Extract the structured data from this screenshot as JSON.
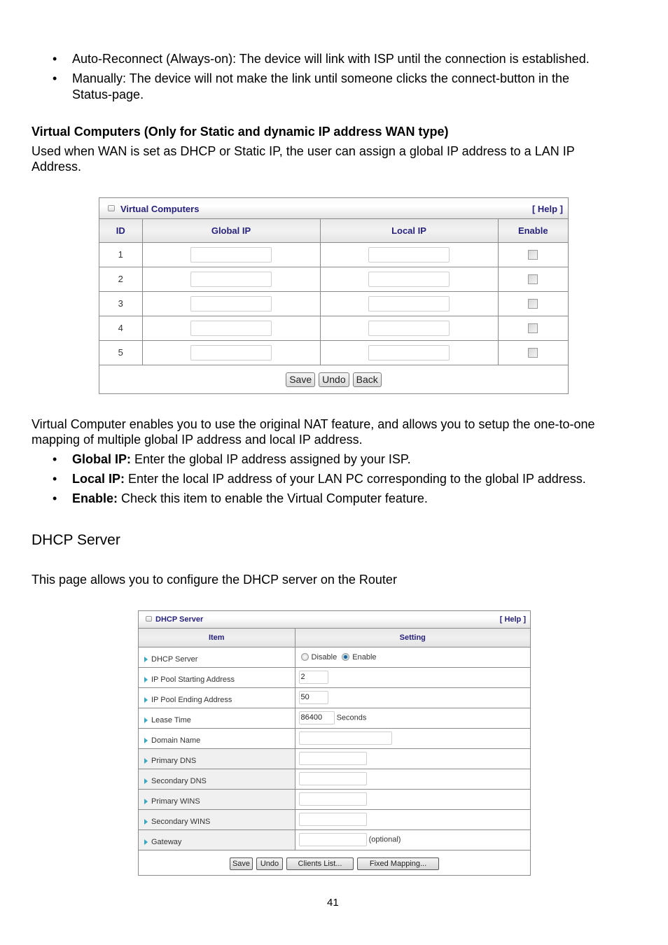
{
  "intro_bullets": [
    "Auto-Reconnect (Always-on): The device will link with ISP until the connection is established.",
    "Manually: The device will not make the link until someone clicks the connect-button in the",
    "Status-page."
  ],
  "virtual_section": {
    "heading": "Virtual Computers (Only for Static and dynamic IP address WAN type)",
    "desc_line1": "Used when WAN is set as DHCP or Static IP, the user can assign a global IP address to a LAN IP",
    "desc_line2": "Address."
  },
  "vc_panel": {
    "title": "Virtual Computers",
    "help": "[ Help ]",
    "columns": [
      "ID",
      "Global IP",
      "Local IP",
      "Enable"
    ],
    "rows": [
      {
        "id": "1",
        "global_ip": "",
        "local_ip": "",
        "enabled": false
      },
      {
        "id": "2",
        "global_ip": "",
        "local_ip": "",
        "enabled": false
      },
      {
        "id": "3",
        "global_ip": "",
        "local_ip": "",
        "enabled": false
      },
      {
        "id": "4",
        "global_ip": "",
        "local_ip": "",
        "enabled": false
      },
      {
        "id": "5",
        "global_ip": "",
        "local_ip": "",
        "enabled": false
      }
    ],
    "buttons": {
      "save": "Save",
      "undo": "Undo",
      "back": "Back"
    }
  },
  "vc_explain": {
    "line1": "Virtual Computer enables you to use the original NAT feature, and allows you to setup the one-to-one",
    "line2": "mapping of multiple global IP address and local IP address.",
    "bullets": [
      {
        "term": "Global IP:",
        "text": " Enter the global IP address assigned by your ISP."
      },
      {
        "term": "Local IP:",
        "text": " Enter the local IP address of your LAN PC corresponding to the global IP address."
      },
      {
        "term": "Enable:",
        "text": " Check this item to enable the Virtual Computer feature."
      }
    ]
  },
  "dhcp_section": {
    "title": "DHCP Server",
    "desc": "This page allows you to configure the DHCP server on the Router"
  },
  "dhcp_panel": {
    "title": "DHCP Server",
    "help": "[ Help ]",
    "columns": [
      "Item",
      "Setting"
    ],
    "dhcp_server": {
      "label": "DHCP Server",
      "options": [
        "Disable",
        "Enable"
      ],
      "selected": "Enable"
    },
    "pool_start": {
      "label": "IP Pool Starting Address",
      "value": "2"
    },
    "pool_end": {
      "label": "IP Pool Ending Address",
      "value": "50"
    },
    "lease_time": {
      "label": "Lease Time",
      "value": "86400",
      "unit": "Seconds"
    },
    "domain_name": {
      "label": "Domain Name",
      "value": ""
    },
    "primary_dns": {
      "label": "Primary DNS",
      "value": ""
    },
    "secondary_dns": {
      "label": "Secondary DNS",
      "value": ""
    },
    "primary_wins": {
      "label": "Primary WINS",
      "value": ""
    },
    "secondary_wins": {
      "label": "Secondary WINS",
      "value": ""
    },
    "gateway": {
      "label": "Gateway",
      "value": "",
      "note": "(optional)"
    },
    "buttons": {
      "save": "Save",
      "undo": "Undo",
      "clients": "Clients List...",
      "fixed": "Fixed Mapping..."
    }
  },
  "page_number": "41"
}
